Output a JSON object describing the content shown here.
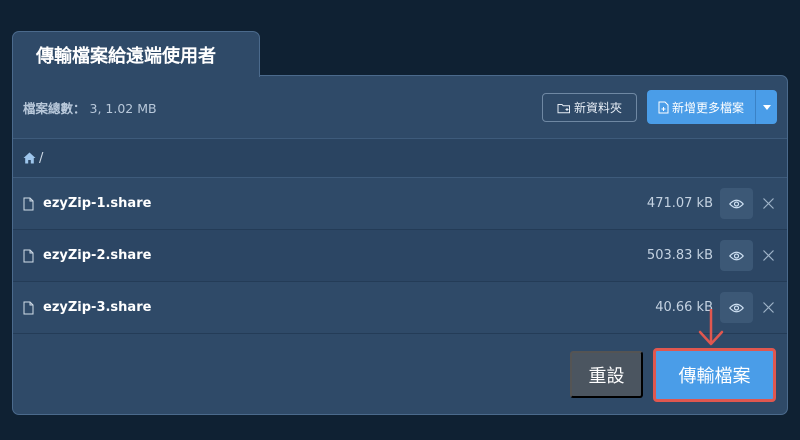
{
  "dialog": {
    "title": "傳輸檔案給遠端使用者"
  },
  "toolbar": {
    "summary_label": "檔案總數：",
    "summary_value": "3, 1.02 MB",
    "new_folder_label": "新資料夾",
    "add_more_label": "新增更多檔案"
  },
  "breadcrumb": {
    "path": "/"
  },
  "files": [
    {
      "name": "ezyZip-1.share",
      "size": "471.07 kB"
    },
    {
      "name": "ezyZip-2.share",
      "size": "503.83 kB"
    },
    {
      "name": "ezyZip-3.share",
      "size": "40.66 kB"
    }
  ],
  "footer": {
    "reset_label": "重設",
    "transfer_label": "傳輸檔案"
  },
  "colors": {
    "background": "#0f2133",
    "panel": "#2f4a68",
    "primary": "#4a9de8",
    "highlight": "#e0574f"
  },
  "icons": {
    "folder": "folder-plus-icon",
    "file": "file-icon",
    "home": "home-icon",
    "preview": "eye-icon",
    "remove": "close-icon"
  }
}
